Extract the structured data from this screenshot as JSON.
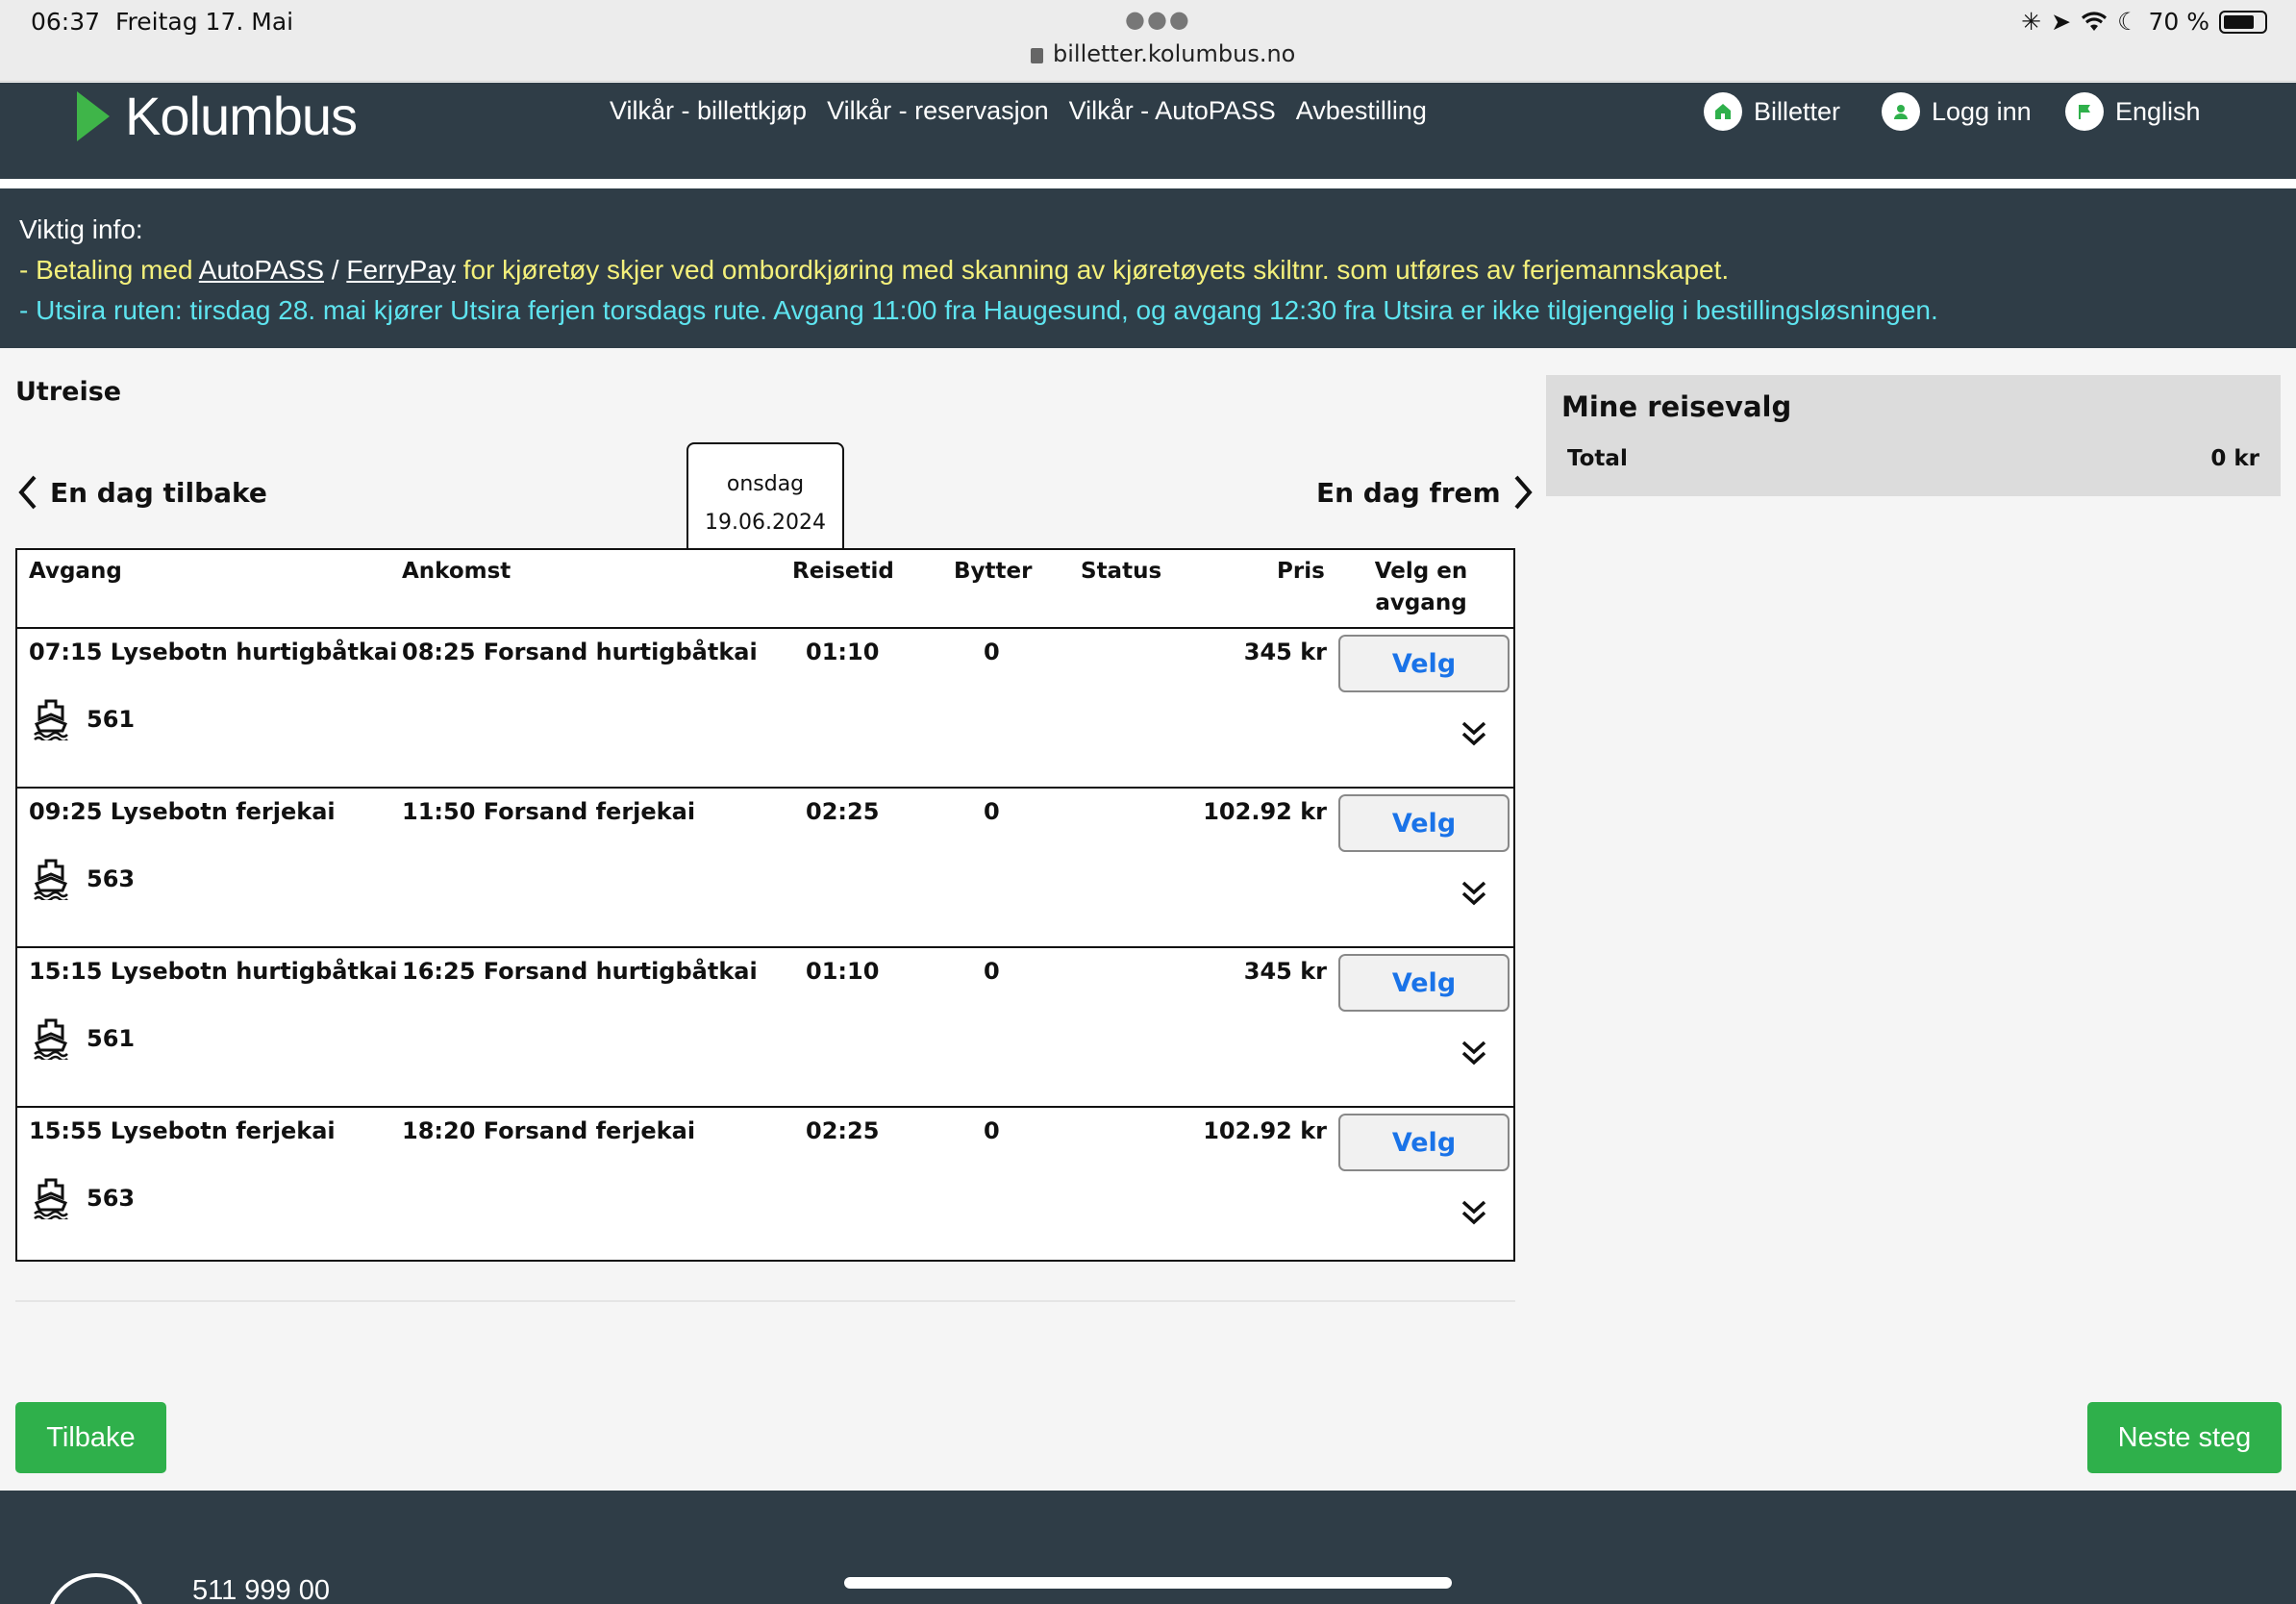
{
  "status_bar": {
    "time": "06:37",
    "date": "Freitag 17. Mai",
    "url": "billetter.kolumbus.no",
    "battery": "70 %"
  },
  "header": {
    "logo": "Kolumbus",
    "nav": [
      "Vilkår - billettkjøp",
      "Vilkår - reservasjon",
      "Vilkår - AutoPASS",
      "Avbestilling"
    ],
    "billetter": "Billetter",
    "login": "Logg inn",
    "language": "English",
    "accent": "#3fb549",
    "bg": "#2f3d47"
  },
  "info": {
    "title": "Viktig info:",
    "line1_prefix": "- Betaling med ",
    "line1_link1": "AutoPASS",
    "line1_sep": " / ",
    "line1_link2": "FerryPay",
    "line1_suffix": " for kjøretøy skjer ved ombordkjøring med skanning av kjøretøyets skiltnr. som utføres av ferjemannskapet.",
    "line2": "- Utsira ruten: tirsdag 28. mai kjører Utsira ferjen torsdags rute. Avgang 11:00 fra Haugesund, og avgang 12:30 fra Utsira er ikke tilgjengelig i bestillingsløsningen."
  },
  "main": {
    "heading": "Utreise",
    "prev_day": "En dag tilbake",
    "next_day": "En dag frem",
    "weekday": "onsdag",
    "date": "19.06.2024",
    "columns": {
      "avgang": "Avgang",
      "ankomst": "Ankomst",
      "reisetid": "Reisetid",
      "bytter": "Bytter",
      "status": "Status",
      "pris": "Pris",
      "velg": "Velg en avgang"
    },
    "velg_label": "Velg",
    "rows": [
      {
        "avgang": "07:15 Lysebotn hurtigbåtkai",
        "ankomst": "08:25 Forsand hurtigbåtkai",
        "reisetid": "01:10",
        "bytter": "0",
        "status": "",
        "pris": "345 kr",
        "route": "561"
      },
      {
        "avgang": "09:25 Lysebotn ferjekai",
        "ankomst": "11:50 Forsand ferjekai",
        "reisetid": "02:25",
        "bytter": "0",
        "status": "",
        "pris": "102.92 kr",
        "route": "563"
      },
      {
        "avgang": "15:15 Lysebotn hurtigbåtkai",
        "ankomst": "16:25 Forsand hurtigbåtkai",
        "reisetid": "01:10",
        "bytter": "0",
        "status": "",
        "pris": "345 kr",
        "route": "561"
      },
      {
        "avgang": "15:55 Lysebotn ferjekai",
        "ankomst": "18:20 Forsand ferjekai",
        "reisetid": "02:25",
        "bytter": "0",
        "status": "",
        "pris": "102.92 kr",
        "route": "563"
      }
    ]
  },
  "panel": {
    "title": "Mine reisevalg",
    "total_label": "Total",
    "total_value": "0 kr"
  },
  "buttons": {
    "back": "Tilbake",
    "next": "Neste steg"
  },
  "footer": {
    "phone": "511 999 00"
  }
}
